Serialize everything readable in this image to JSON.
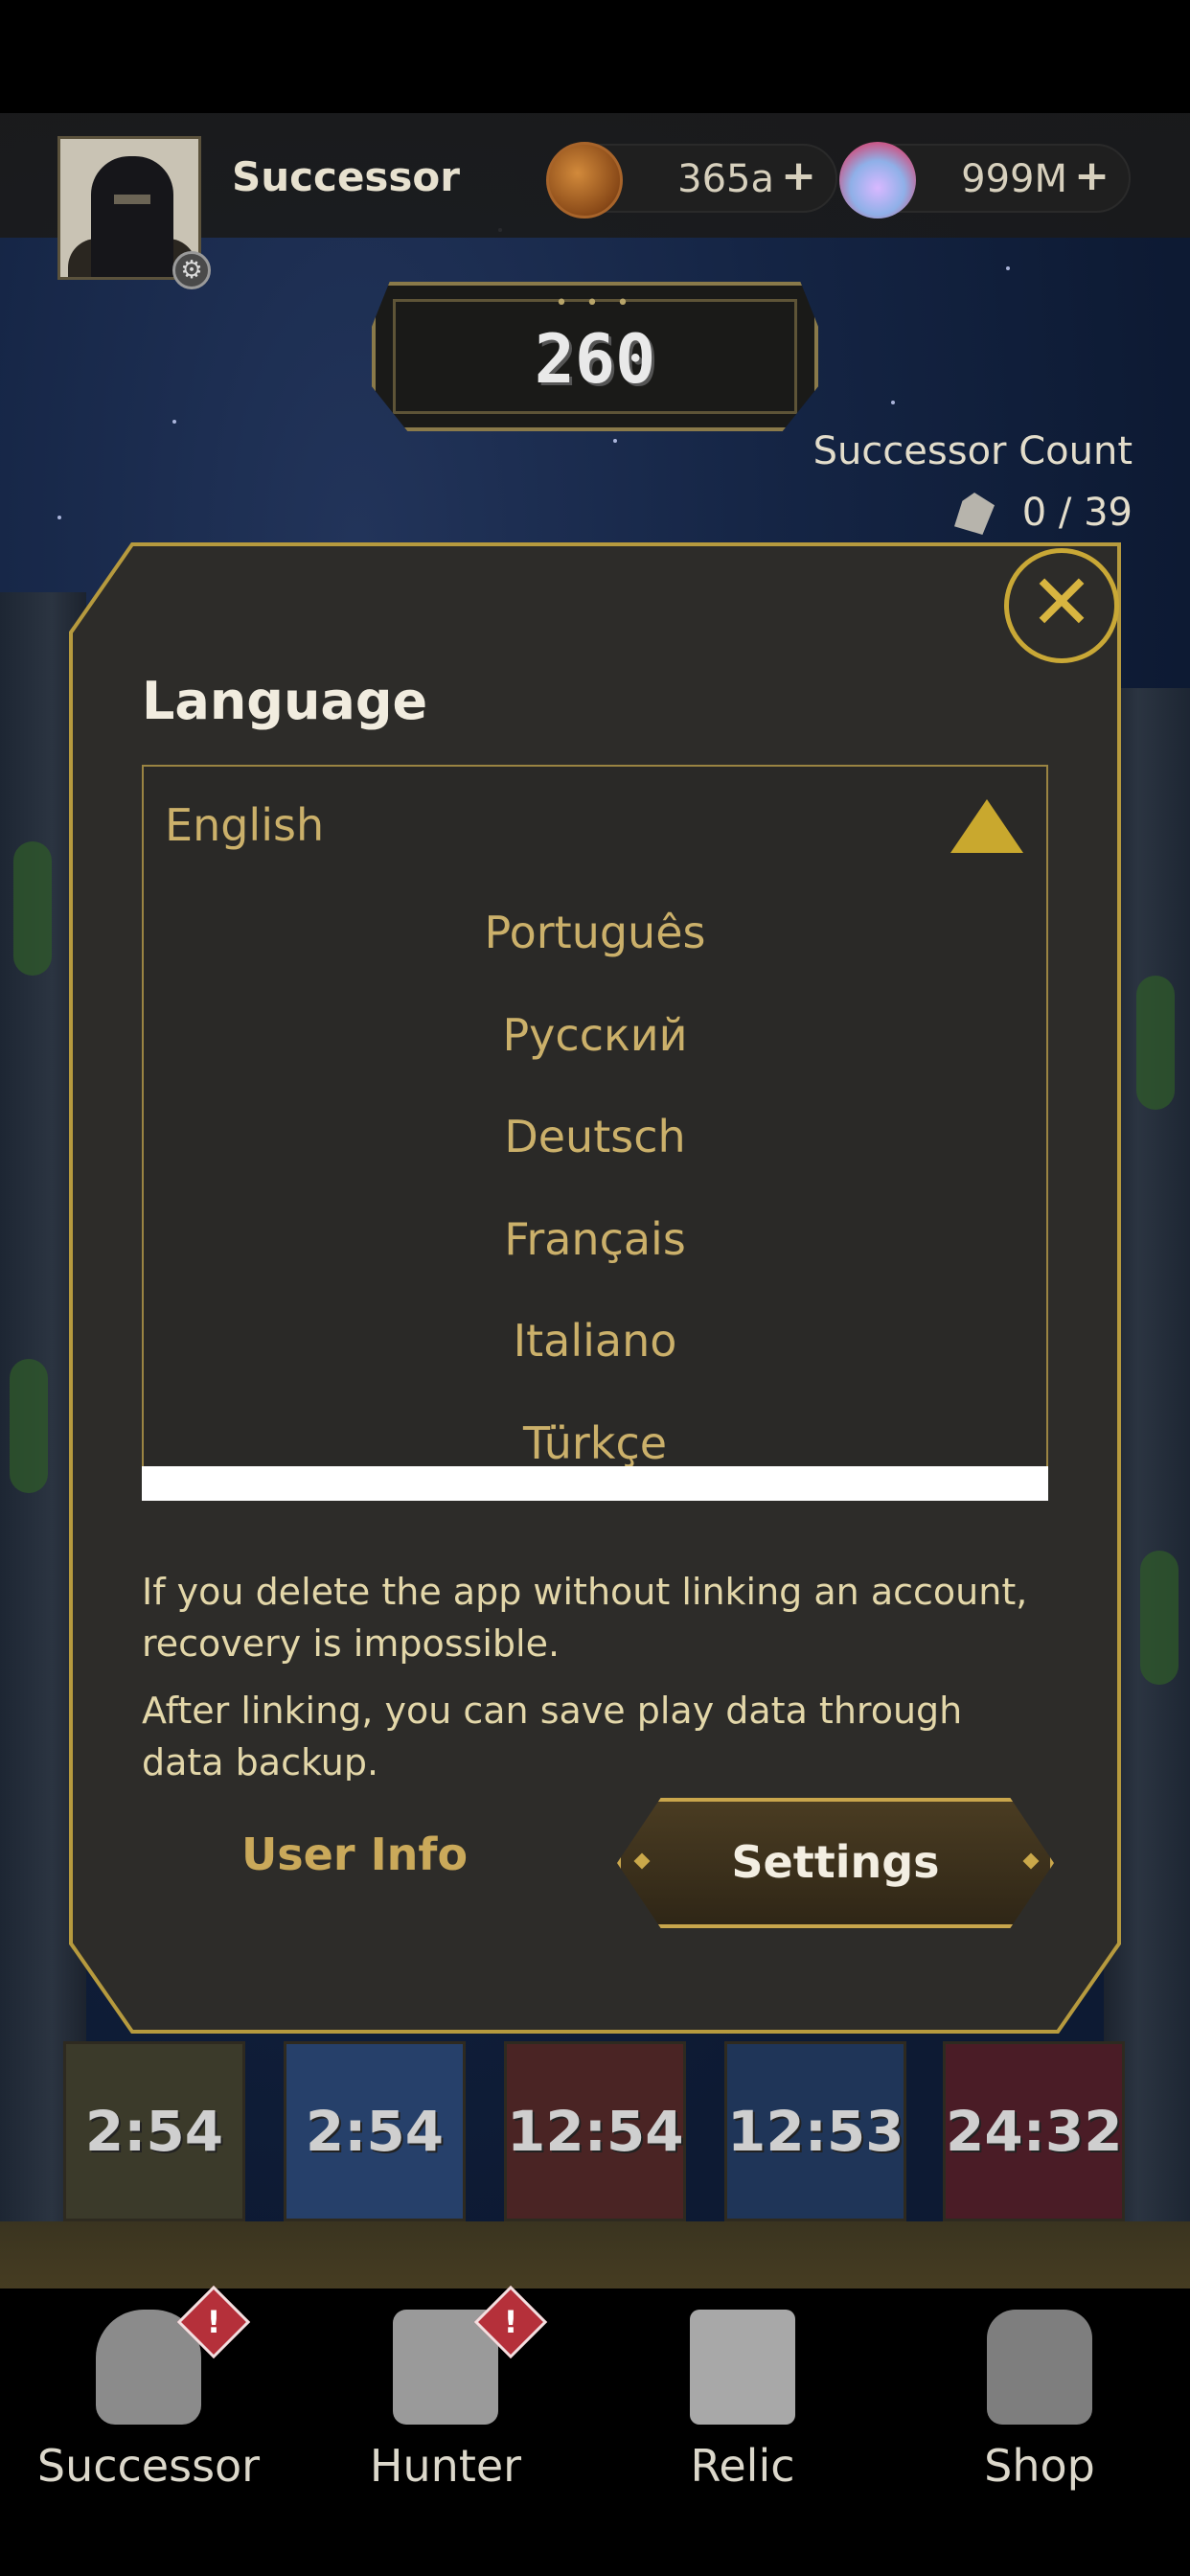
{
  "header": {
    "player_name": "Successor",
    "currency_gold": "365a",
    "currency_potion": "999M",
    "plus": "+",
    "level": "260",
    "successor_count_label": "Successor Count",
    "successor_count_value": "0 / 39"
  },
  "modal": {
    "title": "Language",
    "selected_language": "English",
    "options": [
      "Português",
      "Русский",
      "Deutsch",
      "Français",
      "Italiano",
      "Türkçe"
    ],
    "info_line_1": "If you delete the app without linking an account, recovery is impossible.",
    "info_line_2": "After linking, you can save play data through data backup.",
    "user_info_label": "User Info",
    "settings_label": "Settings",
    "close_symbol": "✕"
  },
  "cooldowns": [
    "2:54",
    "2:54",
    "12:54",
    "12:53",
    "24:32"
  ],
  "nav": {
    "items": [
      {
        "label": "Successor",
        "badge": "!"
      },
      {
        "label": "Hunter",
        "badge": "!"
      },
      {
        "label": "Relic",
        "badge": ""
      },
      {
        "label": "Shop",
        "badge": ""
      }
    ]
  },
  "colors": {
    "accent_gold": "#c9a836",
    "modal_bg": "#2d2c29",
    "badge_red": "#b5303a"
  },
  "icons": {
    "close": "close-icon",
    "caret": "caret-up-icon",
    "settings_gear": "gear-icon"
  }
}
